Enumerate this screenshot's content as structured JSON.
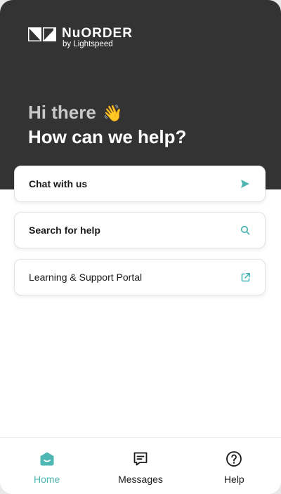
{
  "brand": {
    "name": "NuORDER",
    "byline": "by Lightspeed"
  },
  "hero": {
    "greeting": "Hi there",
    "greeting_emoji": "👋",
    "question": "How can we help?"
  },
  "actions": [
    {
      "label": "Chat with us",
      "icon": "send-icon"
    },
    {
      "label": "Search for help",
      "icon": "search-icon"
    },
    {
      "label": "Learning & Support Portal",
      "icon": "external-link-icon"
    }
  ],
  "nav": {
    "active": "Home",
    "items": [
      {
        "label": "Home",
        "icon": "home-icon"
      },
      {
        "label": "Messages",
        "icon": "messages-icon"
      },
      {
        "label": "Help",
        "icon": "help-icon"
      }
    ]
  },
  "colors": {
    "accent": "#4fb7b3",
    "hero_bg": "#333333"
  }
}
